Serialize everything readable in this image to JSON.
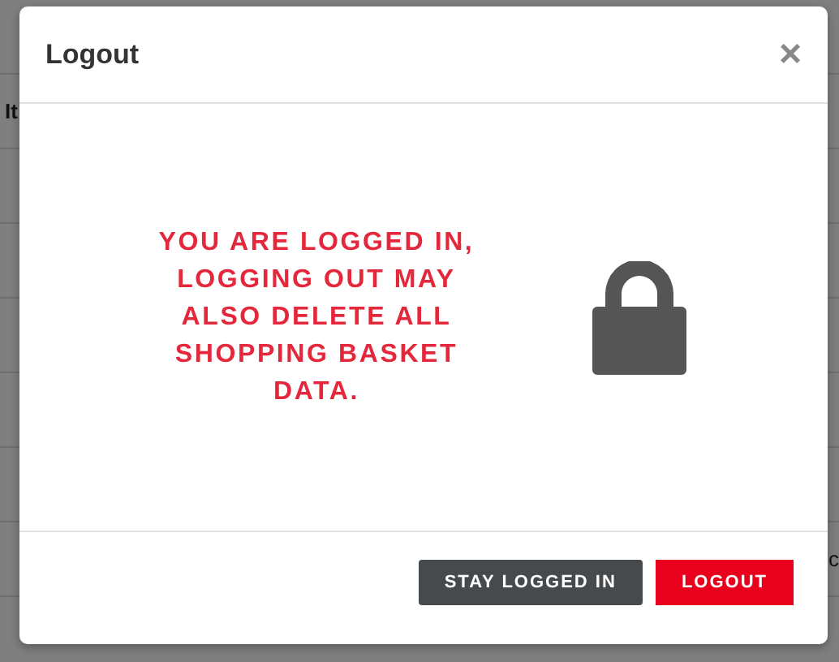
{
  "background": {
    "cell_left": "It",
    "cell_right": "c"
  },
  "dialog": {
    "title": "Logout",
    "close": "×",
    "message": "YOU ARE LOGGED IN, LOGGING OUT MAY ALSO DELETE ALL SHOPPING BASKET DATA.",
    "buttons": [
      {
        "label": "STAY LOGGED IN",
        "kind": "secondary"
      },
      {
        "label": "LOGOUT",
        "kind": "primary"
      }
    ]
  }
}
